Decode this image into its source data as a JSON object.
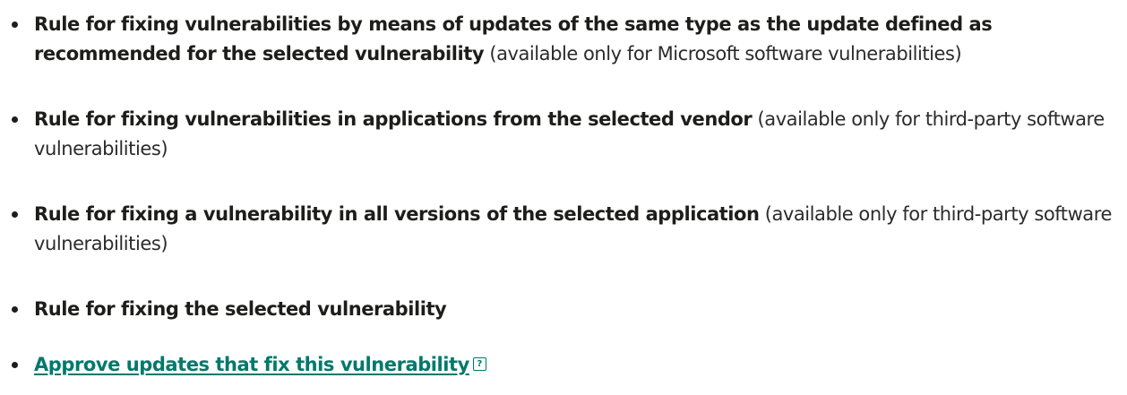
{
  "rules": [
    {
      "title": "Rule for fixing vulnerabilities by means of updates of the same type as the update defined as recommended for the selected vulnerability",
      "note": "(available only for Microsoft software vulnerabilities)"
    },
    {
      "title": "Rule for fixing vulnerabilities in applications from the selected vendor",
      "note": "(available only for third-party software vulnerabilities)"
    },
    {
      "title": "Rule for fixing a vulnerability in all versions of the selected application",
      "note": "(available only for third-party software vulnerabilities)"
    },
    {
      "title": "Rule for fixing the selected vulnerability",
      "note": ""
    }
  ],
  "approve_link": {
    "label": "Approve updates that fix this vulnerability",
    "help_icon": "help-icon",
    "help_glyph": "?"
  },
  "colors": {
    "text": "#1d1d1b",
    "link": "#00796b"
  }
}
